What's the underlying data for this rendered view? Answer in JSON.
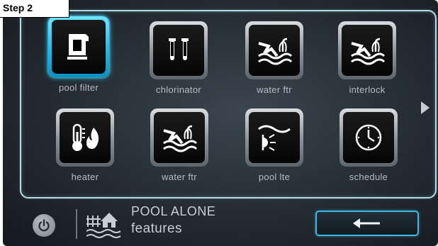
{
  "step_label": "Step 2",
  "colors": {
    "accent": "#27c3f5",
    "panel_border": "#b8d9e6",
    "label": "#b5bcc2"
  },
  "tiles": [
    {
      "label": "pool filter",
      "icon": "pool-filter-icon",
      "selected": true
    },
    {
      "label": "chlorinator",
      "icon": "chlorinator-icon",
      "selected": false
    },
    {
      "label": "water ftr",
      "icon": "water-feature-icon",
      "selected": false
    },
    {
      "label": "interlock",
      "icon": "water-feature-icon",
      "selected": false
    },
    {
      "label": "heater",
      "icon": "heater-icon",
      "selected": false
    },
    {
      "label": "water ftr",
      "icon": "water-feature-icon",
      "selected": false
    },
    {
      "label": "pool lte",
      "icon": "pool-light-icon",
      "selected": false
    },
    {
      "label": "schedule",
      "icon": "clock-icon",
      "selected": false
    }
  ],
  "footer": {
    "mode_title": "POOL ALONE",
    "mode_subtitle": "features",
    "power_icon": "power-icon",
    "mode_icon": "pool-house-icon",
    "back_icon": "arrow-left-icon"
  }
}
